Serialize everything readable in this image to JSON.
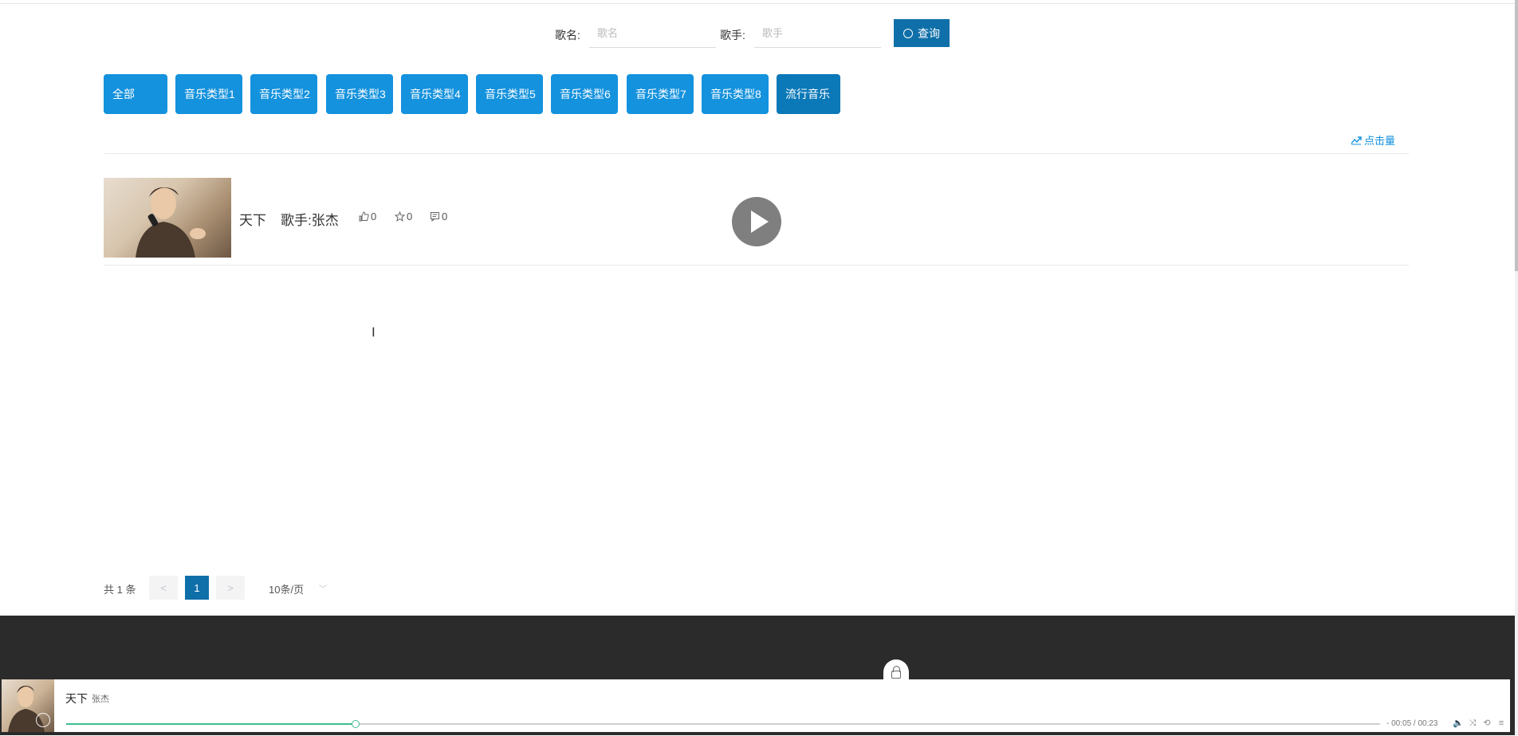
{
  "search": {
    "song_label": "歌名:",
    "song_placeholder": "歌名",
    "singer_label": "歌手:",
    "singer_placeholder": "歌手",
    "query_label": "查询"
  },
  "categories": [
    "全部",
    "音乐类型1",
    "音乐类型2",
    "音乐类型3",
    "音乐类型4",
    "音乐类型5",
    "音乐类型6",
    "音乐类型7",
    "音乐类型8",
    "流行音乐"
  ],
  "sort": {
    "hits_label": "点击量"
  },
  "songs": [
    {
      "name": "天下",
      "singer": "歌手:张杰",
      "likes": "0",
      "favorites": "0",
      "comments": "0"
    }
  ],
  "pagination": {
    "total_text": "共 1 条",
    "prev": "<",
    "current": "1",
    "next": ">",
    "page_size": "10条/页"
  },
  "player": {
    "title": "天下",
    "artist": "张杰",
    "time": "- 00:05 / 00:23",
    "progress": 0.22
  },
  "colors": {
    "primary": "#1592dd",
    "dark_primary": "#0f6fa8",
    "footer": "#2b2b2b",
    "progress": "#3fbf8f"
  }
}
